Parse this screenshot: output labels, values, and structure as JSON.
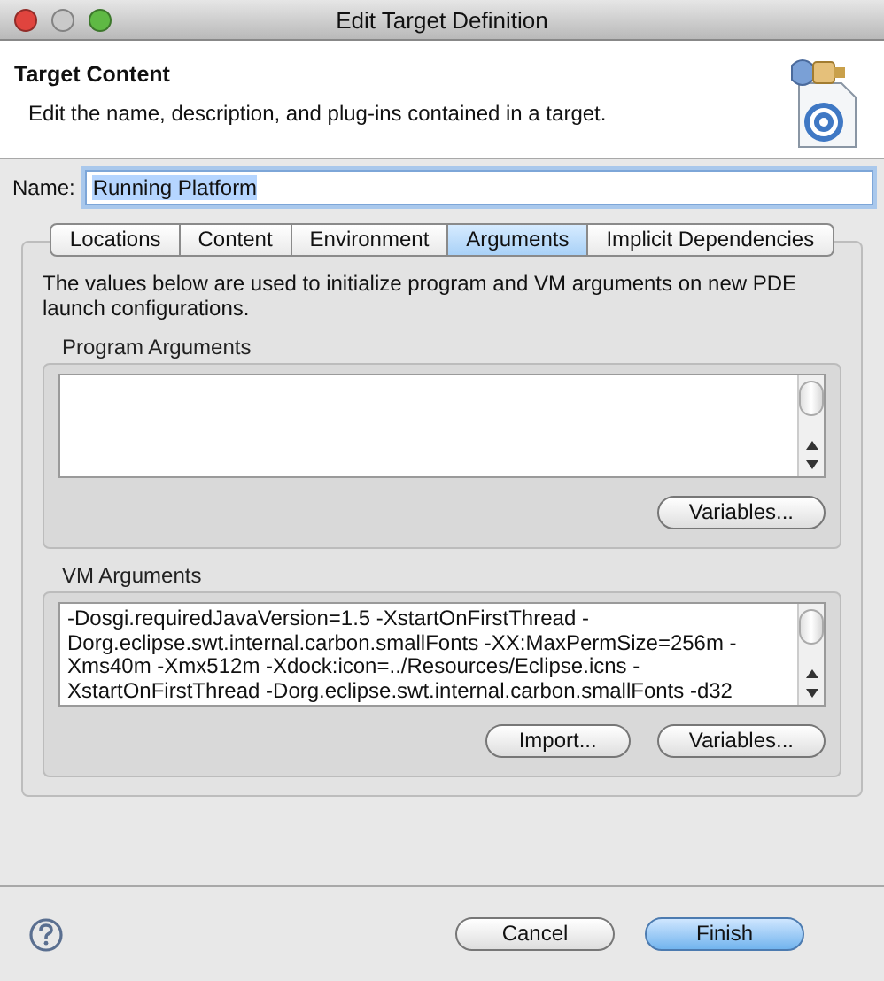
{
  "window": {
    "title": "Edit Target Definition"
  },
  "header": {
    "title": "Target Content",
    "description": "Edit the name, description, and plug-ins contained in a target."
  },
  "name_field": {
    "label": "Name:",
    "value": "Running Platform"
  },
  "tabs": [
    {
      "label": "Locations",
      "selected": false
    },
    {
      "label": "Content",
      "selected": false
    },
    {
      "label": "Environment",
      "selected": false
    },
    {
      "label": "Arguments",
      "selected": true
    },
    {
      "label": "Implicit Dependencies",
      "selected": false
    }
  ],
  "intro": "The values below are used to initialize program and VM arguments on new PDE launch configurations.",
  "groups": [
    {
      "label": "Program Arguments",
      "buttons": [
        "Variables..."
      ]
    },
    {
      "label": "VM Arguments",
      "value": "-Dosgi.requiredJavaVersion=1.5 -XstartOnFirstThread -Dorg.eclipse.swt.internal.carbon.smallFonts -XX:MaxPermSize=256m -Xms40m -Xmx512m -Xdock:icon=../Resources/Eclipse.icns -XstartOnFirstThread -Dorg.eclipse.swt.internal.carbon.smallFonts -d32",
      "buttons": [
        "Import...",
        "Variables..."
      ]
    }
  ],
  "footer_buttons": [
    {
      "label": "Cancel",
      "kind": "normal"
    },
    {
      "label": "Finish",
      "kind": "default"
    }
  ]
}
